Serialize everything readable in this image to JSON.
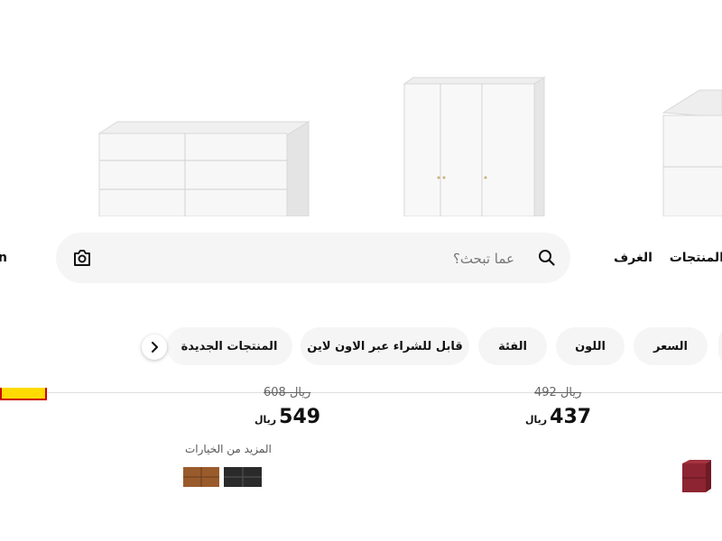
{
  "nav": {
    "products": "المنتجات",
    "rooms": "الغرف",
    "edge_letter": "n"
  },
  "search": {
    "placeholder": "عما تبحث؟"
  },
  "filters": [
    {
      "label": "السعر"
    },
    {
      "label": "اللون"
    },
    {
      "label": "الفئة"
    },
    {
      "label": "قابل للشراء عبر الاون لاين"
    },
    {
      "label": "المنتجات الجديدة"
    }
  ],
  "products": [
    {
      "old_price": "492 ريال",
      "price": "437",
      "currency": "ريال"
    },
    {
      "old_price": "608 ريال",
      "price": "549",
      "currency": "ريال",
      "more_options": "المزيد من الخيارات",
      "swatches": [
        "#9a5b2c",
        "#2a2a2a"
      ]
    }
  ],
  "colors": {
    "accent_red": "#cc0008",
    "accent_yellow": "#ffdb00",
    "pill_bg": "#f5f5f5"
  }
}
